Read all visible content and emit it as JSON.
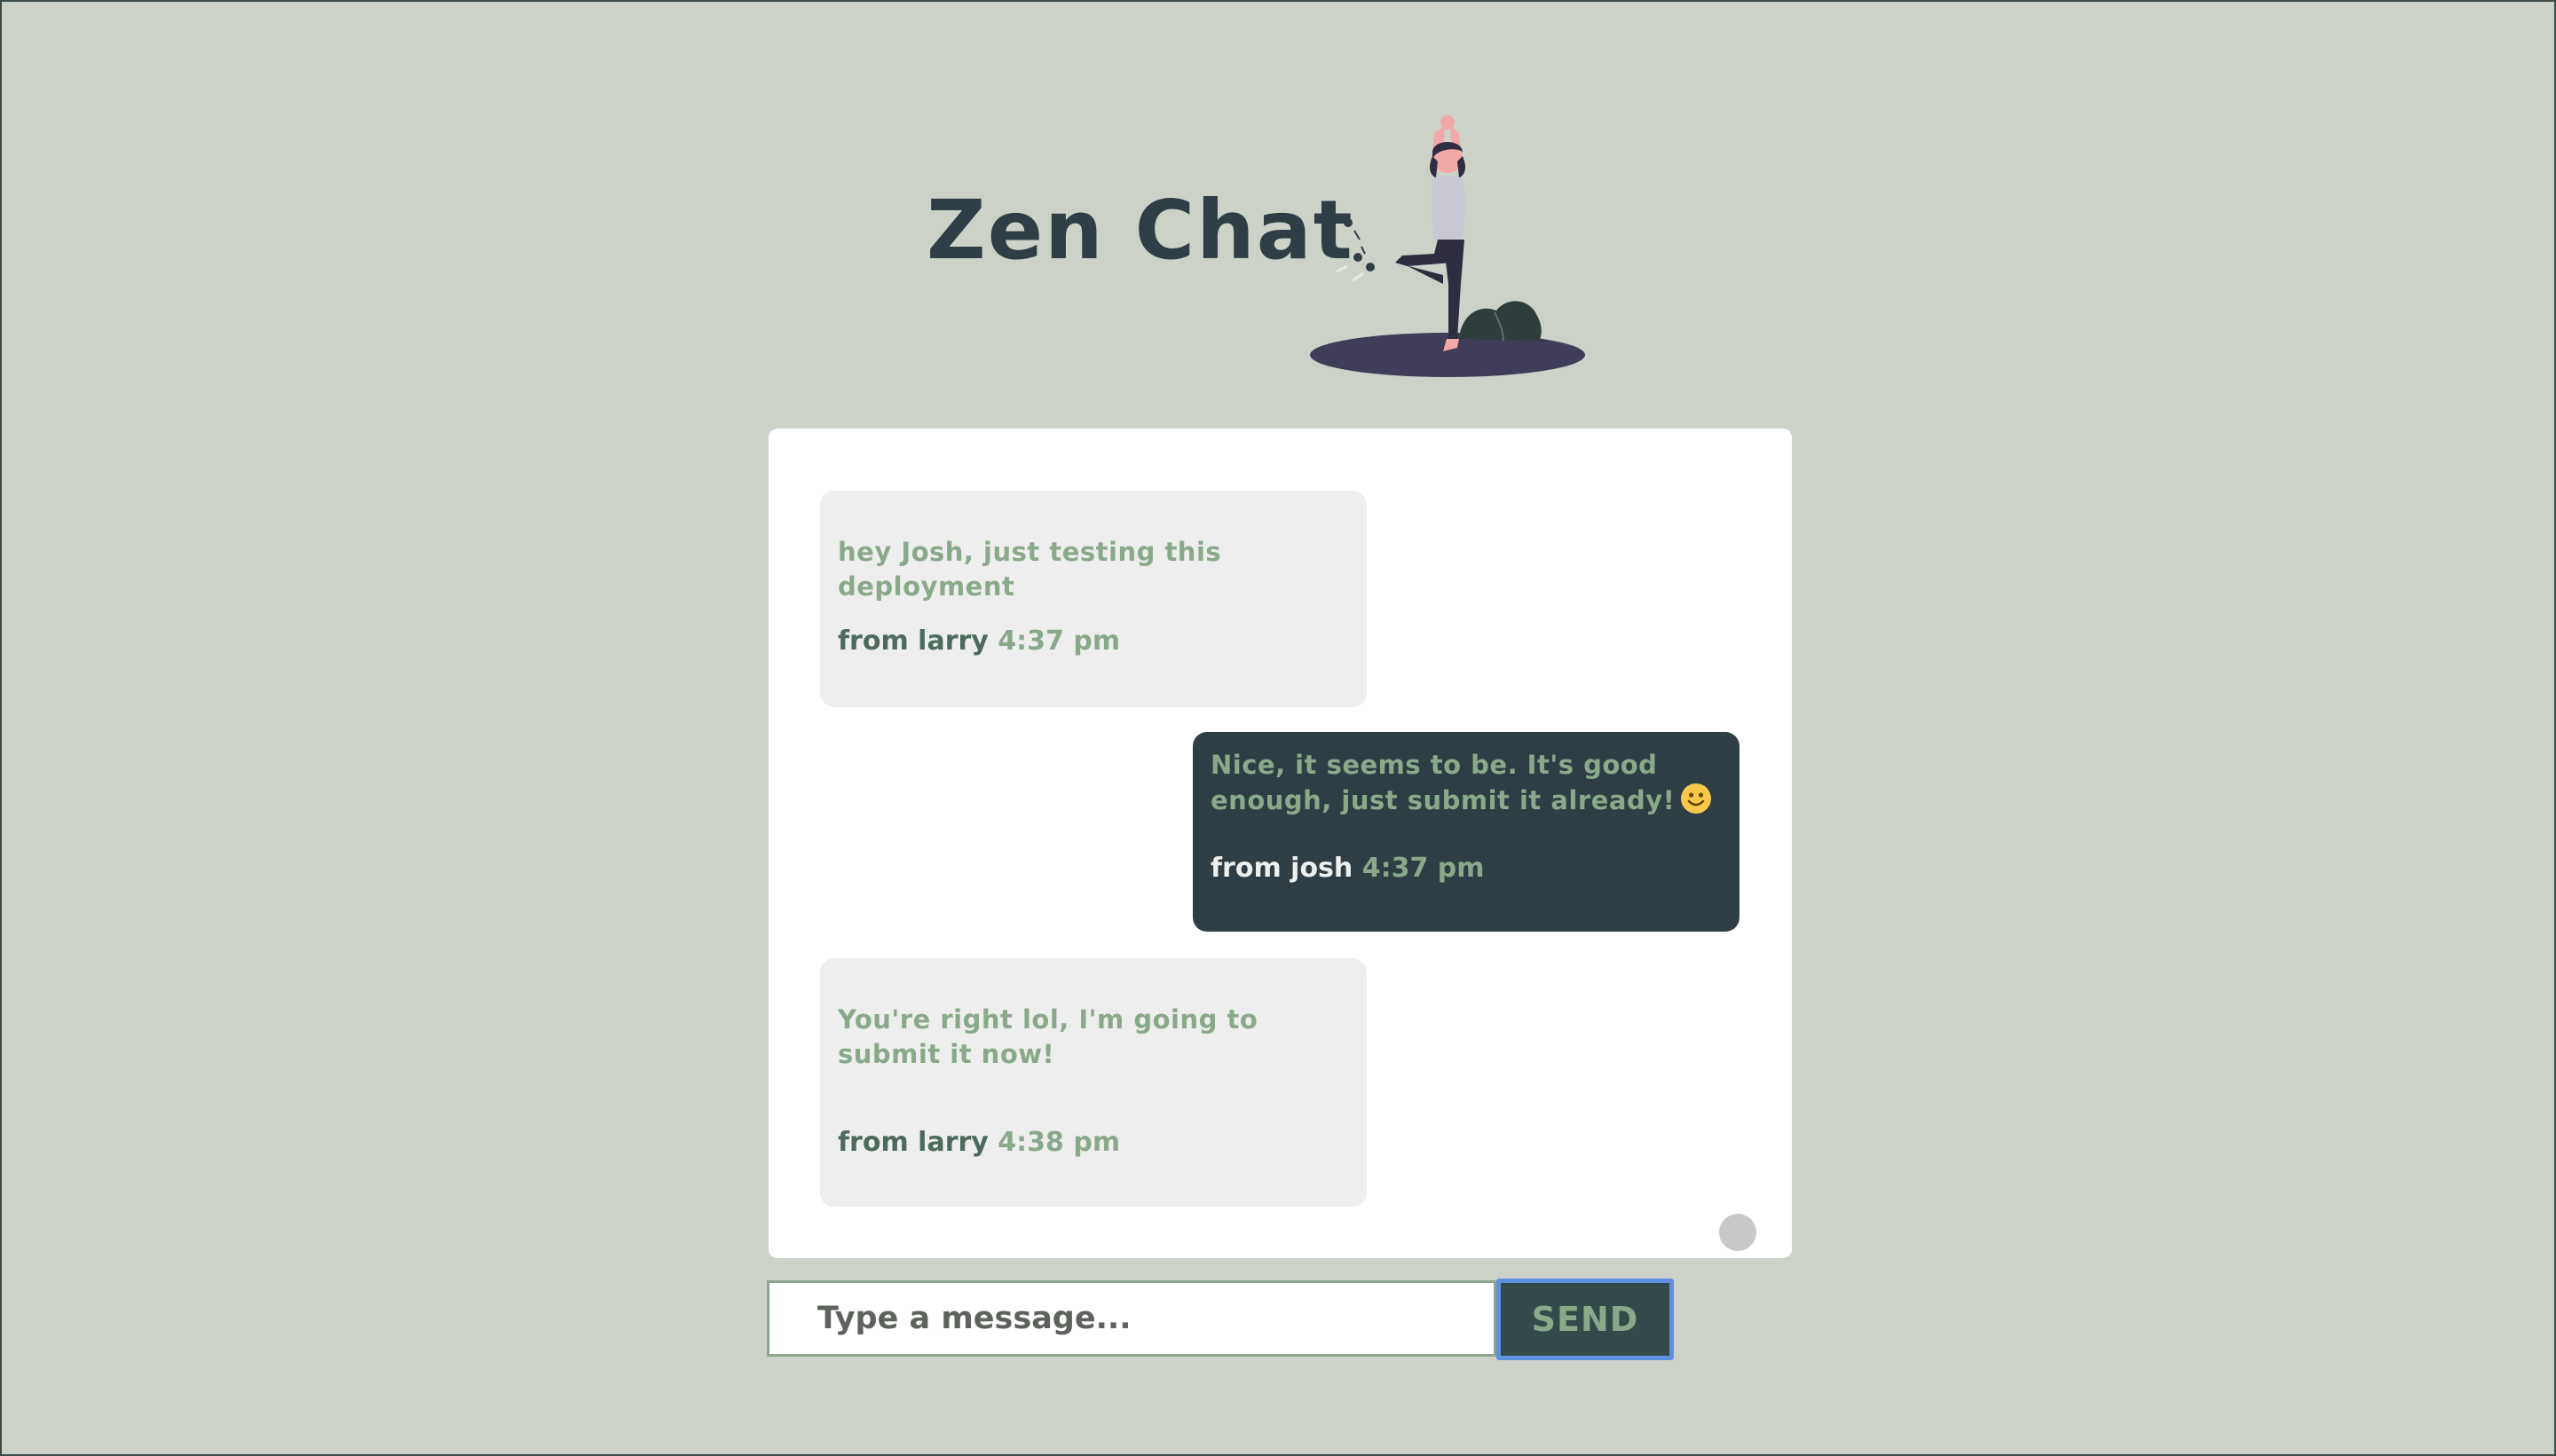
{
  "app": {
    "title": "Zen Chat"
  },
  "messages": [
    {
      "text": "hey Josh, just testing this deployment",
      "from": "from larry",
      "time": "4:37 pm",
      "direction": "incoming"
    },
    {
      "text": "Nice, it seems to be. It's good enough, just submit it already!",
      "emoji": "slightly-smiling-face-emoji",
      "from": "from josh",
      "time": "4:37 pm",
      "direction": "outgoing"
    },
    {
      "text": "You're right lol, I'm going to submit it now!",
      "from": "from larry",
      "time": "4:38 pm",
      "direction": "incoming"
    }
  ],
  "composer": {
    "placeholder": "Type a message...",
    "value": "",
    "send_label": "SEND"
  },
  "colors": {
    "background": "#ccd2c8",
    "title": "#2f3e44",
    "incoming_bubble": "#eeeeee",
    "outgoing_bubble": "#2f3d44",
    "accent_text": "#8aa98a",
    "send_button": "#344a4a",
    "focus_ring": "#5e92e0"
  },
  "icons": {
    "illustration": "yoga-woman-illustration",
    "scroll_indicator": "scroll-indicator"
  }
}
